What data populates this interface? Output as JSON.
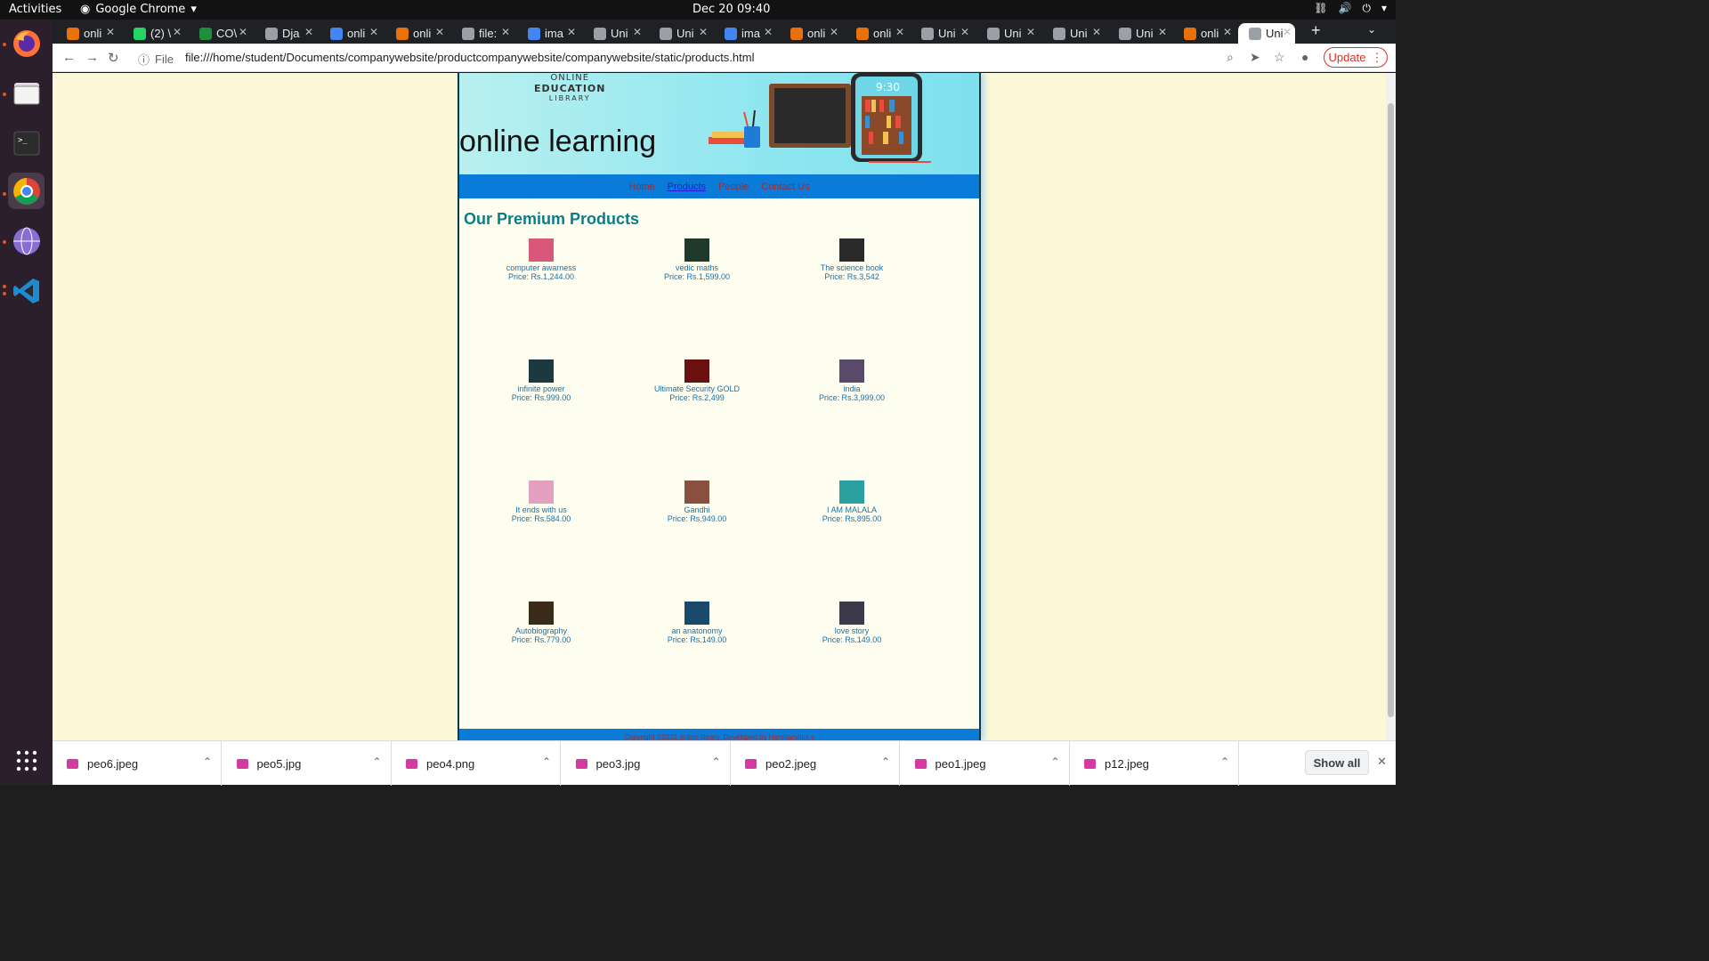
{
  "system": {
    "activities": "Activities",
    "app_name": "Google Chrome",
    "clock": "Dec 20  09:40"
  },
  "tabs": [
    {
      "label": "onli",
      "color": "#e8710a"
    },
    {
      "label": "(2) \\",
      "color": "#25d366"
    },
    {
      "label": "CO\\",
      "color": "#1e8e3e"
    },
    {
      "label": "Dja",
      "color": "#9aa0a6"
    },
    {
      "label": "onli",
      "color": "#4285f4"
    },
    {
      "label": "onli",
      "color": "#e8710a"
    },
    {
      "label": "file:",
      "color": "#9aa0a6"
    },
    {
      "label": "ima",
      "color": "#4285f4"
    },
    {
      "label": "Uni",
      "color": "#9aa0a6"
    },
    {
      "label": "Uni",
      "color": "#9aa0a6"
    },
    {
      "label": "ima",
      "color": "#4285f4"
    },
    {
      "label": "onli",
      "color": "#e8710a"
    },
    {
      "label": "onli",
      "color": "#e8710a"
    },
    {
      "label": "Uni",
      "color": "#9aa0a6"
    },
    {
      "label": "Uni",
      "color": "#9aa0a6"
    },
    {
      "label": "Uni",
      "color": "#9aa0a6"
    },
    {
      "label": "Uni",
      "color": "#9aa0a6"
    },
    {
      "label": "onli",
      "color": "#e8710a"
    },
    {
      "label": "Uni",
      "color": "#9aa0a6"
    }
  ],
  "omnibox": {
    "file_label": "File",
    "url": "file:///home/student/Documents/companywebsite/productcompanywebsite/companywebsite/static/products.html",
    "update_label": "Update"
  },
  "site": {
    "logo_line1": "ONLINE",
    "logo_line2": "EDUCATION",
    "logo_line3": "LIBRARY",
    "banner_title": "online learning",
    "phone_time": "9:30",
    "nav": [
      {
        "label": "Home",
        "current": false
      },
      {
        "label": "Products",
        "current": true
      },
      {
        "label": "People",
        "current": false
      },
      {
        "label": "Contact Us",
        "current": false
      }
    ],
    "heading": "Our Premium Products",
    "products": [
      {
        "name": "computer awarness",
        "price": "Price: Rs.1,244.00",
        "cover": "#d9577a"
      },
      {
        "name": "vedic maths",
        "price": "Price: Rs.1,599.00",
        "cover": "#1f3a2a"
      },
      {
        "name": "The science book",
        "price": "Price: Rs.3,542",
        "cover": "#2a2a2a"
      },
      {
        "name": "infinite power",
        "price": "Price: Rs.999.00",
        "cover": "#1a3a40"
      },
      {
        "name": "Ultimate Security GOLD",
        "price": "Price: Rs.2,499",
        "cover": "#6a1010"
      },
      {
        "name": "india",
        "price": "Price: Rs.3,999.00",
        "cover": "#5a4a6a"
      },
      {
        "name": "It ends with us",
        "price": "Price: Rs.584.00",
        "cover": "#e3a0c0"
      },
      {
        "name": "Gandhi",
        "price": "Price: Rs.949.00",
        "cover": "#8a5040"
      },
      {
        "name": "I AM MALALA",
        "price": "Price: Rs.895.00",
        "cover": "#2aa0a0"
      },
      {
        "name": "Autobiography",
        "price": "Price: Rs.779.00",
        "cover": "#3a2a1a"
      },
      {
        "name": "an anatonomy",
        "price": "Price: Rs.149.00",
        "cover": "#1a4a6a"
      },
      {
        "name": "love story",
        "price": "Price: Rs.149.00",
        "cover": "#3a3a4a"
      }
    ],
    "footer": "Copyright ©2021 online library. Developed by Harsharshini.s"
  },
  "downloads": [
    {
      "name": "peo6.jpeg"
    },
    {
      "name": "peo5.jpg"
    },
    {
      "name": "peo4.png"
    },
    {
      "name": "peo3.jpg"
    },
    {
      "name": "peo2.jpeg"
    },
    {
      "name": "peo1.jpeg"
    },
    {
      "name": "p12.jpeg"
    }
  ],
  "show_all_label": "Show all"
}
